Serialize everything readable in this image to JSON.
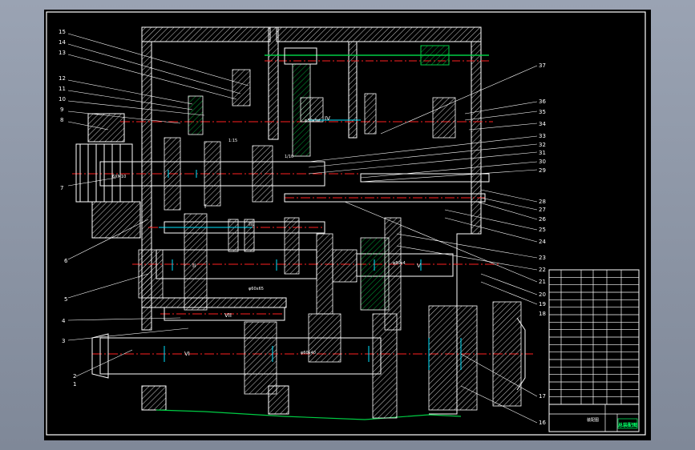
{
  "colors": {
    "background": "#8c95a6",
    "sheet": "#000000",
    "outline": "#ffffff",
    "hatch": "#ffffff",
    "axis": "#ff2020",
    "dimension": "#00e5ff",
    "ground": "#00cc44",
    "title": "#00ff66"
  },
  "drawing": {
    "left_labels": [
      "15",
      "14",
      "13",
      "12",
      "11",
      "10",
      "9",
      "8",
      "7",
      "6",
      "5",
      "4",
      "3",
      "2",
      "1"
    ],
    "right_labels": [
      "37",
      "36",
      "35",
      "34",
      "33",
      "32",
      "31",
      "30",
      "29",
      "28",
      "27",
      "26",
      "25",
      "24",
      "23",
      "22",
      "21",
      "20",
      "19",
      "18",
      "17",
      "16"
    ],
    "shaft_labels": [
      "I",
      "II",
      "III",
      "IV",
      "V",
      "VI",
      "VII"
    ],
    "dimension_marks": [
      "6XM10",
      "φ60x65",
      "φ60x40",
      "1/10",
      "1:15",
      "φ80x4",
      "φ30x9d"
    ]
  },
  "title_block": {
    "title": "装配图",
    "stamp": "总装配图",
    "rows": 18
  }
}
